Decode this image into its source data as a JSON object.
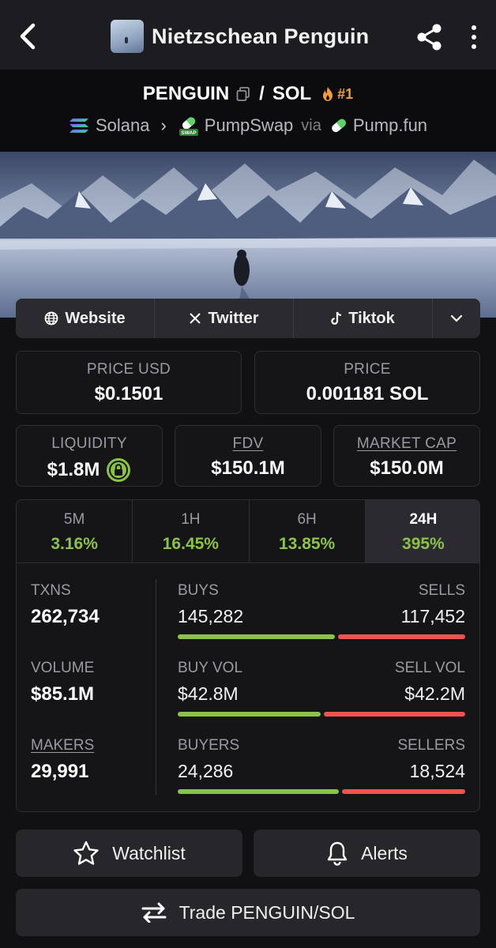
{
  "header": {
    "title": "Nietzschean Penguin"
  },
  "pair": {
    "base": "PENGUIN",
    "separator": "/",
    "quote": "SOL",
    "rank": "#1",
    "chain": "Solana",
    "dex": "PumpSwap",
    "via": "via",
    "launchpad": "Pump.fun",
    "swap_badge": "SWAP"
  },
  "links": {
    "website": "Website",
    "twitter": "Twitter",
    "tiktok": "Tiktok"
  },
  "stats": {
    "price_usd_label": "PRICE USD",
    "price_usd": "$0.1501",
    "price_label": "PRICE",
    "price": "0.001181 SOL",
    "liquidity_label": "LIQUIDITY",
    "liquidity": "$1.8M",
    "fdv_label": "FDV",
    "fdv": "$150.1M",
    "mcap_label": "MARKET CAP",
    "mcap": "$150.0M"
  },
  "timeframes": [
    {
      "label": "5M",
      "value": "3.16%"
    },
    {
      "label": "1H",
      "value": "16.45%"
    },
    {
      "label": "6H",
      "value": "13.85%"
    },
    {
      "label": "24H",
      "value": "395%"
    }
  ],
  "activity": {
    "txns_label": "TXNS",
    "txns": "262,734",
    "volume_label": "VOLUME",
    "volume": "$85.1M",
    "makers_label": "MAKERS",
    "makers": "29,991",
    "buys_label": "BUYS",
    "buys": "145,282",
    "sells_label": "SELLS",
    "sells": "117,452",
    "buy_vol_label": "BUY VOL",
    "buy_vol": "$42.8M",
    "sell_vol_label": "SELL VOL",
    "sell_vol": "$42.2M",
    "buyers_label": "BUYERS",
    "buyers": "24,286",
    "sellers_label": "SELLERS",
    "sellers": "18,524",
    "buy_share_txns": 0.553,
    "buy_share_vol": 0.503,
    "buy_share_makers": 0.567
  },
  "actions": {
    "watchlist": "Watchlist",
    "alerts": "Alerts",
    "trade": "Trade PENGUIN/SOL"
  },
  "colors": {
    "positive": "#8bc34a",
    "negative": "#ef5350",
    "rank": "#f39c3d"
  }
}
